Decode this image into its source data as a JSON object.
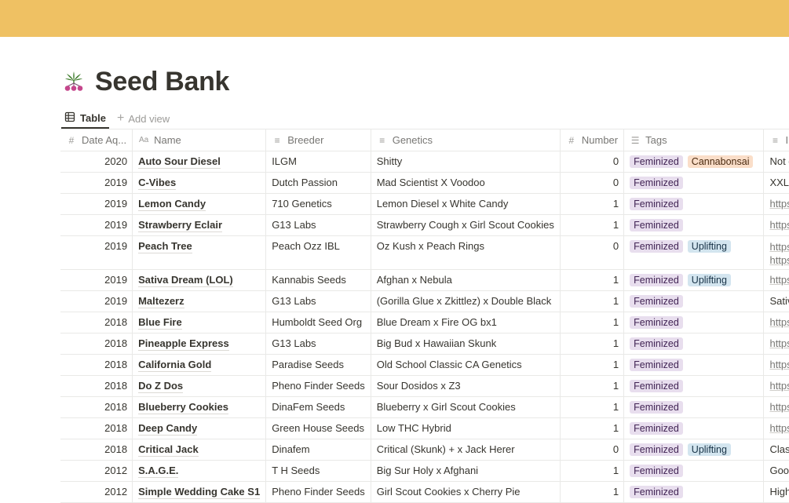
{
  "page": {
    "title": "Seed Bank",
    "icon": "cannabis-leaf-over-three-pink-seeds",
    "banner_color": "#efc163"
  },
  "views": {
    "active_tab": "Table",
    "add_view_label": "Add view"
  },
  "table": {
    "columns": [
      {
        "label": "Date Aq...",
        "icon": "number-icon"
      },
      {
        "label": "Name",
        "icon": "text-aa-icon"
      },
      {
        "label": "Breeder",
        "icon": "text-lines-icon"
      },
      {
        "label": "Genetics",
        "icon": "text-lines-icon"
      },
      {
        "label": "Number",
        "icon": "number-icon"
      },
      {
        "label": "Tags",
        "icon": "multi-select-icon"
      },
      {
        "label": "Info",
        "icon": "text-lines-icon"
      }
    ],
    "rows": [
      {
        "year": "2020",
        "name": "Auto Sour Diesel",
        "breeder": "ILGM",
        "genetics": "Shitty",
        "number": "0",
        "tags": [
          {
            "label": "Feminized",
            "color": "purple"
          },
          {
            "label": "Cannabonsai",
            "color": "orange"
          }
        ],
        "info": [
          "Not grea"
        ],
        "info_is_url": false
      },
      {
        "year": "2019",
        "name": "C-Vibes",
        "breeder": "Dutch Passion",
        "genetics": "Mad Scientist X Voodoo",
        "number": "0",
        "tags": [
          {
            "label": "Feminized",
            "color": "purple"
          }
        ],
        "info": [
          "XXL Yiel"
        ],
        "info_is_url": false
      },
      {
        "year": "2019",
        "name": "Lemon Candy",
        "breeder": "710 Genetics",
        "genetics": "Lemon Diesel x White Candy",
        "number": "1",
        "tags": [
          {
            "label": "Feminized",
            "color": "purple"
          }
        ],
        "info": [
          "https://w"
        ],
        "info_is_url": true
      },
      {
        "year": "2019",
        "name": "Strawberry Eclair",
        "breeder": "G13 Labs",
        "genetics": "Strawberry Cough x Girl Scout Cookies",
        "number": "1",
        "tags": [
          {
            "label": "Feminized",
            "color": "purple"
          }
        ],
        "info": [
          "https://w"
        ],
        "info_is_url": true
      },
      {
        "year": "2019",
        "name": "Peach Tree",
        "breeder": "Peach Ozz IBL",
        "genetics": "Oz Kush x Peach Rings",
        "number": "0",
        "tags": [
          {
            "label": "Feminized",
            "color": "purple"
          },
          {
            "label": "Uplifting",
            "color": "blue"
          }
        ],
        "info": [
          "https://w",
          "https://w"
        ],
        "info_is_url": true
      },
      {
        "year": "2019",
        "name": "Sativa Dream (LOL)",
        "breeder": "Kannabis Seeds",
        "genetics": "Afghan x Nebula",
        "number": "1",
        "tags": [
          {
            "label": "Feminized",
            "color": "purple"
          },
          {
            "label": "Uplifting",
            "color": "blue"
          }
        ],
        "info": [
          "https://w"
        ],
        "info_is_url": true
      },
      {
        "year": "2019",
        "name": "Maltezerz",
        "breeder": "G13 Labs",
        "genetics": "(Gorilla Glue x Zkittlez) x Double Black",
        "number": "1",
        "tags": [
          {
            "label": "Feminized",
            "color": "purple"
          }
        ],
        "info": [
          "Sativa Hy"
        ],
        "info_is_url": false
      },
      {
        "year": "2018",
        "name": "Blue Fire",
        "breeder": "Humboldt Seed Org",
        "genetics": "Blue Dream x Fire OG bx1",
        "number": "1",
        "tags": [
          {
            "label": "Feminized",
            "color": "purple"
          }
        ],
        "info": [
          "https://w"
        ],
        "info_is_url": true
      },
      {
        "year": "2018",
        "name": "Pineapple Express",
        "breeder": "G13 Labs",
        "genetics": "Big Bud x Hawaiian Skunk",
        "number": "1",
        "tags": [
          {
            "label": "Feminized",
            "color": "purple"
          }
        ],
        "info": [
          "https://w"
        ],
        "info_is_url": true
      },
      {
        "year": "2018",
        "name": "California Gold",
        "breeder": "Paradise Seeds",
        "genetics": "Old School Classic CA Genetics",
        "number": "1",
        "tags": [
          {
            "label": "Feminized",
            "color": "purple"
          }
        ],
        "info": [
          "https://w"
        ],
        "info_is_url": true
      },
      {
        "year": "2018",
        "name": "Do Z Dos",
        "breeder": "Pheno Finder Seeds",
        "genetics": "Sour Dosidos x Z3",
        "number": "1",
        "tags": [
          {
            "label": "Feminized",
            "color": "purple"
          }
        ],
        "info": [
          "https://w"
        ],
        "info_is_url": true
      },
      {
        "year": "2018",
        "name": "Blueberry Cookies",
        "breeder": "DinaFem Seeds",
        "genetics": "Blueberry x Girl Scout Cookies",
        "number": "1",
        "tags": [
          {
            "label": "Feminized",
            "color": "purple"
          }
        ],
        "info": [
          "https://w"
        ],
        "info_is_url": true
      },
      {
        "year": "2018",
        "name": "Deep Candy",
        "breeder": "Green House Seeds",
        "genetics": "Low THC Hybrid",
        "number": "1",
        "tags": [
          {
            "label": "Feminized",
            "color": "purple"
          }
        ],
        "info": [
          "https://w"
        ],
        "info_is_url": true
      },
      {
        "year": "2018",
        "name": "Critical Jack",
        "breeder": "Dinafem",
        "genetics": "Critical (Skunk) + x Jack Herer",
        "number": "0",
        "tags": [
          {
            "label": "Feminized",
            "color": "purple"
          },
          {
            "label": "Uplifting",
            "color": "blue"
          }
        ],
        "info": [
          "Classic S"
        ],
        "info_is_url": false
      },
      {
        "year": "2012",
        "name": "S.A.G.E.",
        "breeder": "T H Seeds",
        "genetics": "Big Sur Holy x Afghani",
        "number": "1",
        "tags": [
          {
            "label": "Feminized",
            "color": "purple"
          }
        ],
        "info": [
          "Good for"
        ],
        "info_is_url": false
      },
      {
        "year": "2012",
        "name": "Simple Wedding Cake S1",
        "breeder": "Pheno Finder Seeds",
        "genetics": "Girl Scout Cookies x Cherry Pie",
        "number": "1",
        "tags": [
          {
            "label": "Feminized",
            "color": "purple"
          }
        ],
        "info": [
          "High Tim"
        ],
        "info_is_url": false
      }
    ]
  }
}
